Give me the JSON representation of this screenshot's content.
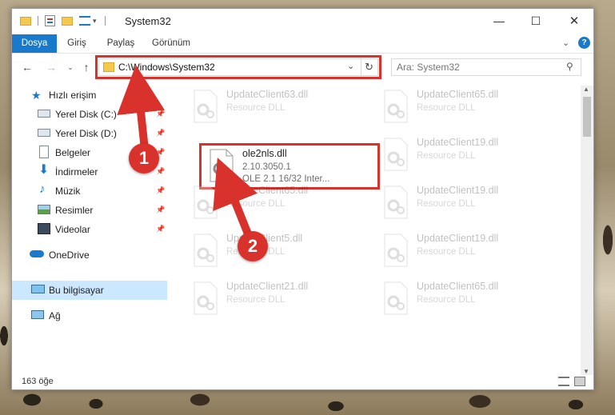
{
  "window": {
    "title": "System32",
    "controls": {
      "minimize": "—",
      "maximize": "☐",
      "close": "✕"
    }
  },
  "ribbon": {
    "tabs": [
      {
        "label": "Dosya",
        "active": true
      },
      {
        "label": "Giriş",
        "active": false
      },
      {
        "label": "Paylaş",
        "active": false
      },
      {
        "label": "Görünüm",
        "active": false
      }
    ]
  },
  "address": {
    "path": "C:\\Windows\\System32"
  },
  "search": {
    "placeholder": "Ara: System32"
  },
  "sidebar": {
    "items": [
      {
        "label": "Hızlı erişim",
        "icon": "star-icon",
        "pinned": false
      },
      {
        "label": "Yerel Disk (C:)",
        "icon": "drive-icon",
        "pinned": true
      },
      {
        "label": "Yerel Disk (D:)",
        "icon": "drive-icon",
        "pinned": true
      },
      {
        "label": "Belgeler",
        "icon": "documents-icon",
        "pinned": true
      },
      {
        "label": "İndirmeler",
        "icon": "download-icon",
        "pinned": true
      },
      {
        "label": "Müzik",
        "icon": "music-icon",
        "pinned": true
      },
      {
        "label": "Resimler",
        "icon": "pictures-icon",
        "pinned": true
      },
      {
        "label": "Videolar",
        "icon": "video-icon",
        "pinned": true
      },
      {
        "label": "OneDrive",
        "icon": "cloud-icon",
        "pinned": false
      },
      {
        "label": "Bu bilgisayar",
        "icon": "computer-icon",
        "pinned": false,
        "selected": true
      },
      {
        "label": "Ağ",
        "icon": "network-icon",
        "pinned": false
      }
    ]
  },
  "files": {
    "left": [
      {
        "name": "UpdateClient63.dll",
        "type": "Resource DLL"
      },
      {
        "name": "ole2nls.dll",
        "version": "2.10.3050.1",
        "description": "OLE 2.1 16/32 Inter..."
      },
      {
        "name": "UpdateClient65.dll",
        "type": "Resource DLL"
      },
      {
        "name": "UpdateClient5.dll",
        "type": "Resource DLL"
      },
      {
        "name": "UpdateClient21.dll",
        "type": "Resource DLL"
      }
    ],
    "right": [
      {
        "name": "UpdateClient65.dll",
        "type": "Resource DLL"
      },
      {
        "name": "UpdateClient19.dll",
        "type": "Resource DLL"
      },
      {
        "name": "UpdateClient19.dll",
        "type": "Resource DLL"
      },
      {
        "name": "UpdateClient19.dll",
        "type": "Resource DLL"
      },
      {
        "name": "UpdateClient65.dll",
        "type": "Resource DLL"
      }
    ]
  },
  "status": {
    "count": "163 öğe"
  },
  "annotations": {
    "badge1": "1",
    "badge2": "2",
    "color": "#d9312b"
  },
  "colors": {
    "accent": "#1979ca",
    "selection": "#cce8ff",
    "highlight": "#d9312b"
  }
}
